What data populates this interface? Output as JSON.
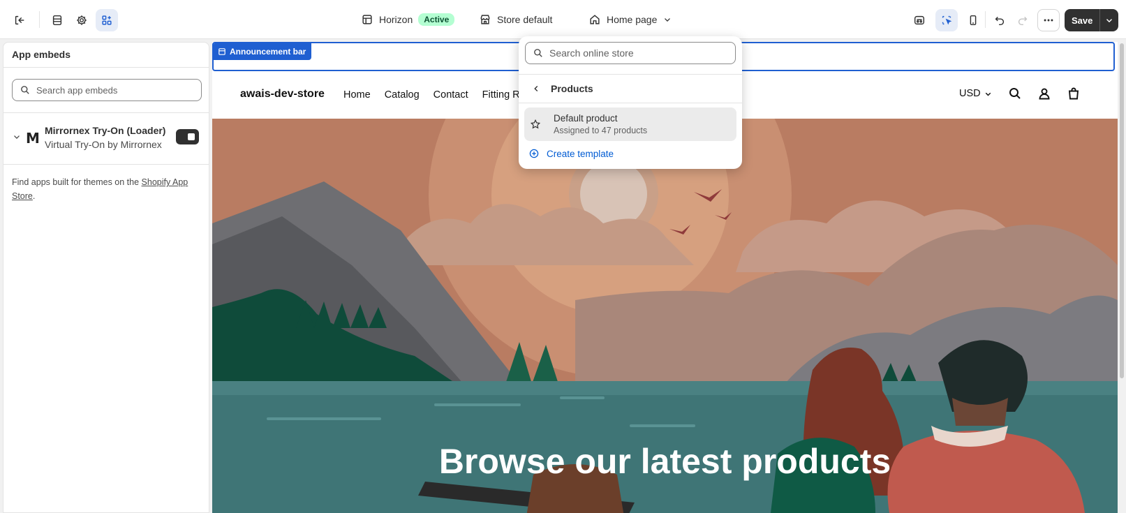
{
  "topbar": {
    "theme_name": "Horizon",
    "theme_status": "Active",
    "store_context": "Store default",
    "page_selector": "Home page",
    "save_label": "Save"
  },
  "sidebar": {
    "title": "App embeds",
    "search_placeholder": "Search app embeds",
    "app": {
      "name": "Mirrornex Try-On (Loader)",
      "subtitle": "Virtual Try-On by Mirrornex",
      "logo_letter": "M",
      "enabled": true
    },
    "find_apps_prefix": "Find apps built for themes on the ",
    "find_apps_link": "Shopify App Store",
    "find_apps_suffix": "."
  },
  "preview": {
    "announcement_tag": "Announcement bar",
    "brand": "awais-dev-store",
    "nav": [
      "Home",
      "Catalog",
      "Contact",
      "Fitting R"
    ],
    "currency": "USD",
    "hero_title": "Browse our latest products"
  },
  "dropdown": {
    "search_placeholder": "Search online store",
    "section_title": "Products",
    "item_title": "Default product",
    "item_subtitle": "Assigned to 47 products",
    "create_label": "Create template"
  },
  "colors": {
    "accent": "#1f5fd1",
    "link": "#005bd3",
    "badge_bg": "#b4fed2",
    "dark_button": "#303030"
  }
}
